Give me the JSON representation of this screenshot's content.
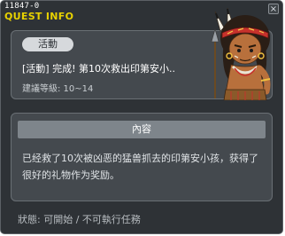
{
  "window": {
    "quest_id": "11847-0",
    "title": "QUEST INFO",
    "close_symbol": "×"
  },
  "quest": {
    "category_tag": "活動",
    "name": "[活動] 完成! 第10次救出印第安小..",
    "recommended_level": "建議等級: 10~14"
  },
  "content": {
    "header": "內容",
    "text": "已经救了10次被凶恶的猛兽抓去的印第安小孩，获得了很好的礼物作为奖励。"
  },
  "status": {
    "text": "狀態: 可開始 / 不可執行任務"
  },
  "npc": {
    "icon": "indian-warrior-npc-portrait"
  },
  "colors": {
    "window_bg": "#2e3236",
    "panel_bg": "#44494e",
    "title_yellow": "#e8d200",
    "header_bar": "#7e858b"
  }
}
